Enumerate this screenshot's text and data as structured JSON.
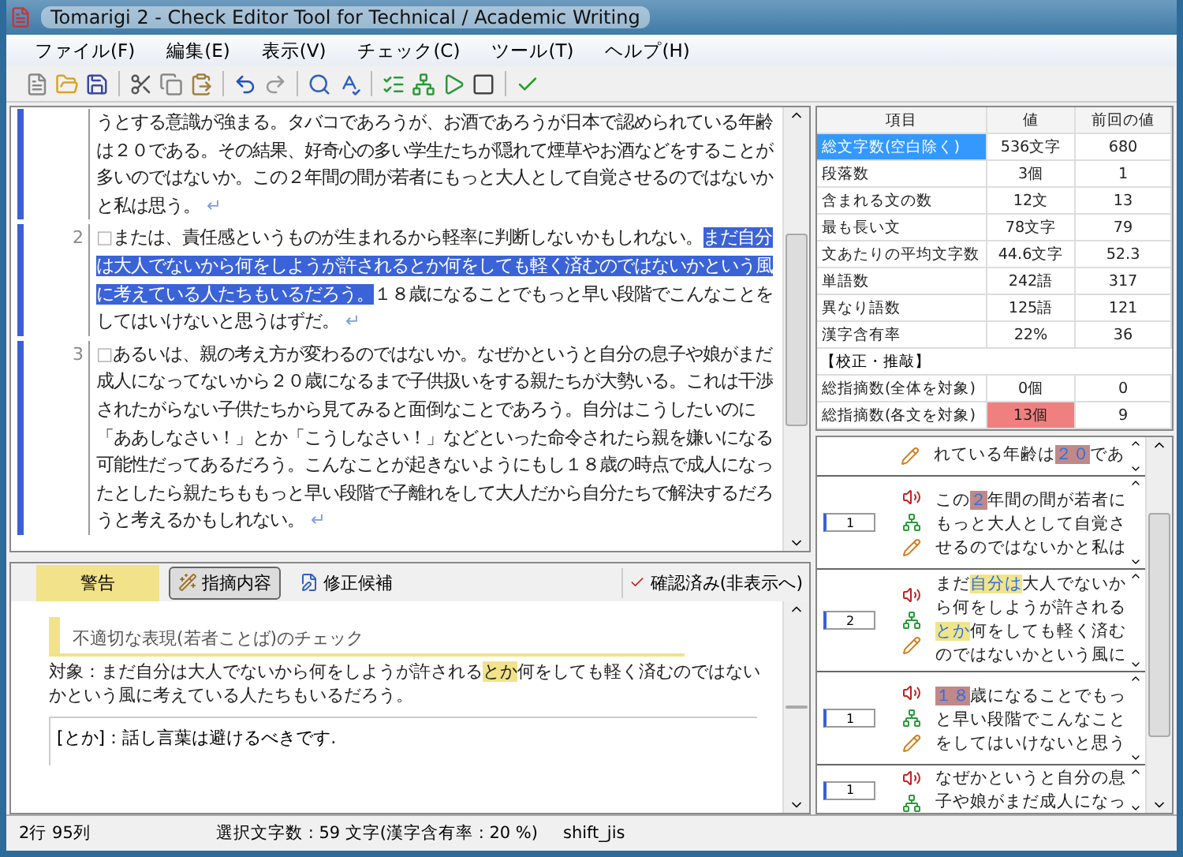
{
  "window": {
    "title": "Tomarigi 2 - Check Editor Tool for Technical / Academic Writing"
  },
  "menu": [
    "ファイル(F)",
    "編集(E)",
    "表示(V)",
    "チェック(C)",
    "ツール(T)",
    "ヘルプ(H)"
  ],
  "editor": {
    "paragraphs": [
      {
        "lines": [
          [
            {
              "text": "うとする意識が強まる。タバコであろうが、お酒であろうが日本で認められている年齢",
              "selected": false
            }
          ],
          [
            {
              "text": "は２０である。その結果、好奇心の多い学生たちが隠れて煙草やお酒などをすることが",
              "selected": false
            }
          ],
          [
            {
              "text": "多いのではないか。この２年間の間が若者にもっと大人として自覚させるのではないか",
              "selected": false
            }
          ],
          [
            {
              "text": "と私は思う。",
              "selected": false
            }
          ]
        ],
        "end_mark": "↵"
      },
      {
        "number": "2",
        "marker": "□",
        "lines": [
          [
            {
              "text": "または、責任感というものが生まれるから軽率に判断しないかもしれない。",
              "selected": false
            },
            {
              "text": "まだ自分",
              "selected": true
            }
          ],
          [
            {
              "text": "は大人でないから何をしようが許されるとか何をしても軽く済むのではないかという風",
              "selected": true
            }
          ],
          [
            {
              "text": "に考えている人たちもいるだろう。",
              "selected": true
            },
            {
              "text": "１８歳になることでもっと早い段階でこんなことを",
              "selected": false
            }
          ],
          [
            {
              "text": "してはいけないと思うはずだ。",
              "selected": false
            }
          ]
        ],
        "end_mark": "↵"
      },
      {
        "number": "3",
        "marker": "□",
        "lines": [
          [
            {
              "text": "あるいは、親の考え方が変わるのではないか。なぜかというと自分の息子や娘がまだ",
              "selected": false
            }
          ],
          [
            {
              "text": "成人になってないから２０歳になるまで子供扱いをする親たちが大勢いる。これは干渉",
              "selected": false
            }
          ],
          [
            {
              "text": "されたがらない子供たちから見てみると面倒なことであろう。自分はこうしたいのに",
              "selected": false
            }
          ],
          [
            {
              "text": "「ああしなさい！」とか「こうしなさい！」などといった命令されたら親を嫌いになる",
              "selected": false
            }
          ],
          [
            {
              "text": "可能性だってあるだろう。こんなことが起きないようにもし１８歳の時点で成人になっ",
              "selected": false
            }
          ],
          [
            {
              "text": "たとしたら親たちももっと早い段階で子離れをして大人だから自分たちで解決するだろ",
              "selected": false
            }
          ],
          [
            {
              "text": "うと考えるかもしれない。",
              "selected": false
            }
          ]
        ],
        "end_mark": "↵"
      }
    ]
  },
  "stats": {
    "columns": [
      "項目",
      "値",
      "前回の値"
    ],
    "rows": [
      {
        "kind": "stat",
        "cells": [
          "総文字数(空白除く)",
          "536文字",
          "680"
        ],
        "selected": true,
        "flagged": false
      },
      {
        "kind": "stat",
        "cells": [
          "段落数",
          "3個",
          "1"
        ],
        "selected": false,
        "flagged": false
      },
      {
        "kind": "stat",
        "cells": [
          "含まれる文の数",
          "12文",
          "13"
        ],
        "selected": false,
        "flagged": false
      },
      {
        "kind": "stat",
        "cells": [
          "最も長い文",
          "78文字",
          "79"
        ],
        "selected": false,
        "flagged": false
      },
      {
        "kind": "stat",
        "cells": [
          "文あたりの平均文字数",
          "44.6文字",
          "52.3"
        ],
        "selected": false,
        "flagged": false
      },
      {
        "kind": "stat",
        "cells": [
          "単語数",
          "242語",
          "317"
        ],
        "selected": false,
        "flagged": false
      },
      {
        "kind": "stat",
        "cells": [
          "異なり語数",
          "125語",
          "121"
        ],
        "selected": false,
        "flagged": false
      },
      {
        "kind": "stat",
        "cells": [
          "漢字含有率",
          "22%",
          "36"
        ],
        "selected": false,
        "flagged": false
      },
      {
        "kind": "section",
        "cells": [
          "【校正・推敲】"
        ]
      },
      {
        "kind": "stat",
        "cells": [
          "総指摘数(全体を対象)",
          "0個",
          "0"
        ],
        "selected": false,
        "flagged": false
      },
      {
        "kind": "stat",
        "cells": [
          "総指摘数(各文を対象)",
          "13個",
          "9"
        ],
        "selected": false,
        "flagged": true
      }
    ]
  },
  "findings": [
    {
      "lines": [
        [
          {
            "text": "れている年齢は",
            "kind": "plain"
          },
          {
            "text": "２０",
            "kind": "number"
          },
          {
            "text": "であ",
            "kind": "plain"
          }
        ]
      ]
    },
    {
      "count": "1",
      "lines": [
        [
          {
            "text": "この",
            "kind": "plain"
          },
          {
            "text": "２",
            "kind": "number"
          },
          {
            "text": "年間の間が若者に",
            "kind": "plain"
          }
        ],
        [
          {
            "text": "もっと大人として自覚さ",
            "kind": "plain"
          }
        ],
        [
          {
            "text": "せるのではないかと私は",
            "kind": "plain"
          }
        ]
      ]
    },
    {
      "count": "2",
      "lines": [
        [
          {
            "text": "まだ",
            "kind": "plain"
          },
          {
            "text": "自分は",
            "kind": "word"
          },
          {
            "text": "大人でないか",
            "kind": "plain"
          }
        ],
        [
          {
            "text": "ら何をしようが許される",
            "kind": "plain"
          }
        ],
        [
          {
            "text": "とか",
            "kind": "word"
          },
          {
            "text": "何をしても軽く済む",
            "kind": "plain"
          }
        ],
        [
          {
            "text": "のではないかという風に",
            "kind": "plain"
          }
        ]
      ]
    },
    {
      "count": "1",
      "lines": [
        [
          {
            "text": "１８",
            "kind": "number"
          },
          {
            "text": "歳になることでもっ",
            "kind": "plain"
          }
        ],
        [
          {
            "text": "と早い段階でこんなこと",
            "kind": "plain"
          }
        ],
        [
          {
            "text": "をしてはいけないと思う",
            "kind": "plain"
          }
        ]
      ]
    },
    {
      "count": "1",
      "lines": [
        [
          {
            "text": "なぜかというと自分の息",
            "kind": "plain"
          }
        ],
        [
          {
            "text": "子や娘がまだ成人になっ",
            "kind": "plain"
          }
        ]
      ]
    }
  ],
  "details": {
    "category": "警告",
    "tabs": [
      {
        "label": "指摘内容",
        "selected": true
      },
      {
        "label": "修正候補",
        "selected": false
      }
    ],
    "confirm": {
      "label": "確認済み(非表示へ)",
      "checked": true
    },
    "heading": "不適切な表現(若者ことば)のチェック",
    "target": [
      {
        "text": "対象：まだ自分は大人でないから何をしようが許される",
        "highlight": false
      },
      {
        "text": "とか",
        "highlight": true
      },
      {
        "text": "何をしても軽く済むのではないかという風に考えている人たちもいるだろう。",
        "highlight": false
      }
    ],
    "message": "[とか]：話し言葉は避けるべきです."
  },
  "status_bar": [
    "2行 95列",
    "選択文字数 : 59 文字(漢字含有率 : 20 %)",
    "shift_jis"
  ]
}
